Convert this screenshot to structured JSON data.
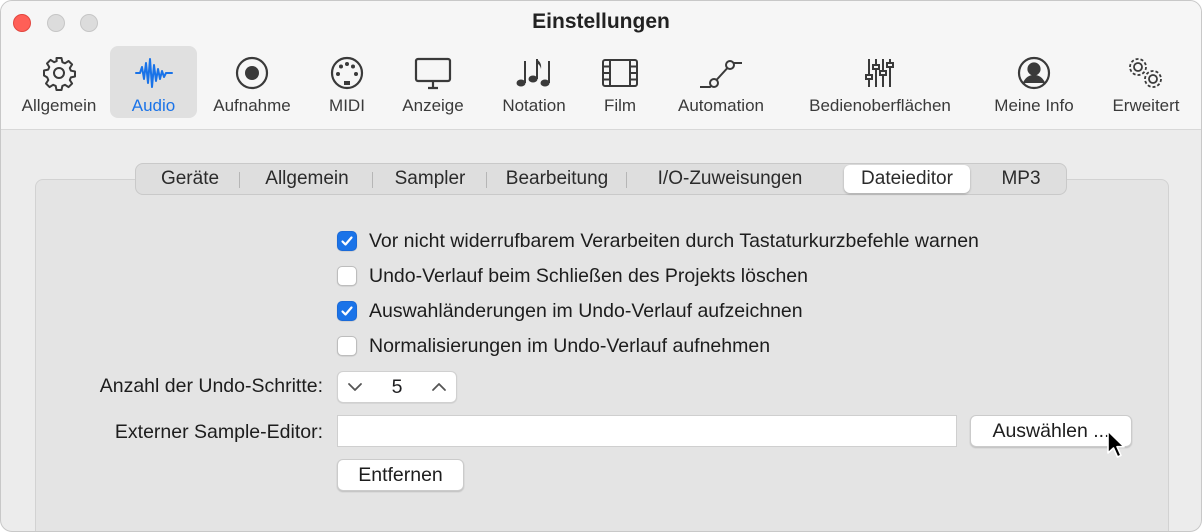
{
  "window": {
    "title": "Einstellungen"
  },
  "toolbar": {
    "items": [
      {
        "label": "Allgemein",
        "icon": "gear-icon"
      },
      {
        "label": "Audio",
        "icon": "waveform-icon",
        "active": true
      },
      {
        "label": "Aufnahme",
        "icon": "record-icon"
      },
      {
        "label": "MIDI",
        "icon": "midi-port-icon"
      },
      {
        "label": "Anzeige",
        "icon": "display-icon"
      },
      {
        "label": "Notation",
        "icon": "music-notes-icon"
      },
      {
        "label": "Film",
        "icon": "film-icon"
      },
      {
        "label": "Automation",
        "icon": "automation-curve-icon"
      },
      {
        "label": "Bedienoberflächen",
        "icon": "faders-icon"
      },
      {
        "label": "Meine Info",
        "icon": "person-icon"
      },
      {
        "label": "Erweitert",
        "icon": "gears-icon"
      }
    ]
  },
  "tabs": [
    {
      "label": "Geräte"
    },
    {
      "label": "Allgemein"
    },
    {
      "label": "Sampler"
    },
    {
      "label": "Bearbeitung"
    },
    {
      "label": "I/O-Zuweisungen"
    },
    {
      "label": "Dateieditor",
      "active": true
    },
    {
      "label": "MP3"
    }
  ],
  "options": [
    {
      "label": "Vor nicht widerrufbarem Verarbeiten durch Tastaturkurzbefehle warnen",
      "checked": true
    },
    {
      "label": "Undo-Verlauf beim Schließen des Projekts löschen",
      "checked": false
    },
    {
      "label": "Auswahländerungen im Undo-Verlauf aufzeichnen",
      "checked": true
    },
    {
      "label": "Normalisierungen im Undo-Verlauf aufnehmen",
      "checked": false
    }
  ],
  "undo_steps": {
    "label": "Anzahl der Undo-Schritte:",
    "value": "5"
  },
  "external_editor": {
    "label": "Externer Sample-Editor:",
    "value": "",
    "choose_label": "Auswählen ...",
    "remove_label": "Entfernen"
  },
  "colors": {
    "accent": "#1a73e8",
    "close": "#ff5f57",
    "window_bg": "#ececec"
  }
}
